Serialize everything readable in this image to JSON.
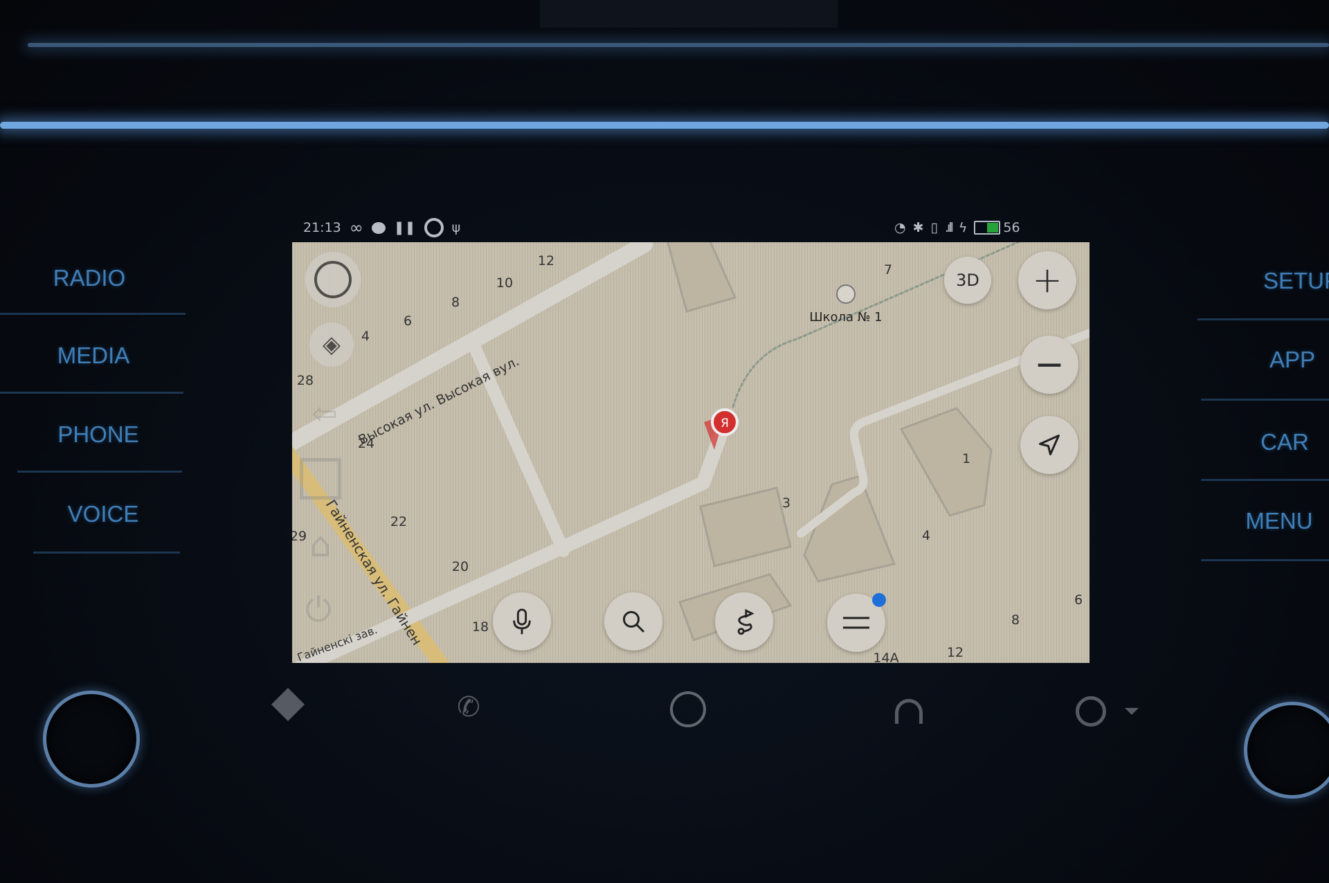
{
  "status_bar": {
    "time": "21:13",
    "left_icons": [
      "infinity-icon",
      "chat-bubble-icon",
      "pause-icon",
      "steering-wheel-icon",
      "usb-icon"
    ],
    "right_icons": [
      "nfc-icon",
      "bluetooth-icon",
      "vibrate-icon",
      "signal-icon",
      "charging-icon",
      "battery-icon"
    ],
    "battery_percent": "56",
    "battery_level": 56
  },
  "head_unit": {
    "left_buttons": [
      {
        "label": "RADIO"
      },
      {
        "label": "MEDIA"
      },
      {
        "label": "PHONE"
      },
      {
        "label": "VOICE"
      }
    ],
    "right_buttons": [
      {
        "label": "SETUP"
      },
      {
        "label": "APP"
      },
      {
        "label": "CAR"
      },
      {
        "label": "MENU"
      }
    ],
    "accent_color": "#3f7fb8"
  },
  "map": {
    "streets": {
      "vysokaya": "Высокая ул.  Высокая вул.",
      "gaynenskaya": "Гайненская ул.  Гайнен",
      "gaynenski_zav": "Гайненскі зав."
    },
    "poi": {
      "label": "Школа № 1",
      "icon": "school-icon"
    },
    "marker_label": "Я",
    "house_numbers": [
      "12",
      "10",
      "8",
      "6",
      "4",
      "28",
      "24",
      "22",
      "29",
      "20",
      "18",
      "7",
      "3",
      "4",
      "1",
      "6",
      "8",
      "12",
      "14A"
    ],
    "controls": {
      "three_d": "3D",
      "zoom_in": "+",
      "zoom_out": "−"
    },
    "route_color": "#d32f2f",
    "notification_dot_color": "#1e6fd8"
  },
  "bottom_nav": [
    "navigation-icon",
    "phone-icon",
    "home-circle-icon",
    "headphones-icon",
    "car-dashboard-icon",
    "dropdown-arrow-icon"
  ]
}
